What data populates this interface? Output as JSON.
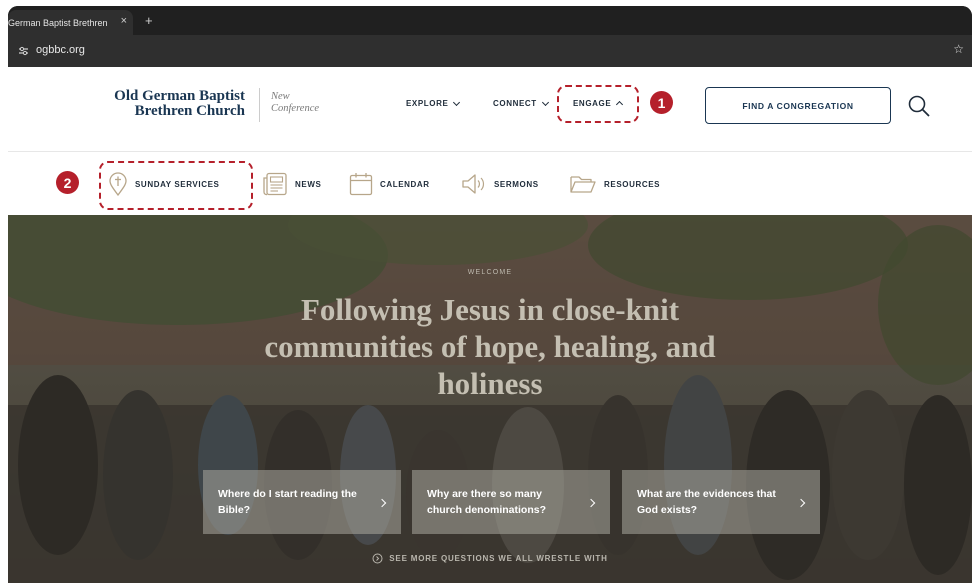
{
  "browser": {
    "tab_title": "German Baptist Brethren",
    "tab_close": "×",
    "new_tab": "+",
    "url": "ogbbc.org",
    "bookmark_icon": "star-icon"
  },
  "header": {
    "logo_line1": "Old German Baptist",
    "logo_line2": "Brethren Church",
    "logo_sub1": "New",
    "logo_sub2": "Conference",
    "nav": [
      {
        "label": "EXPLORE"
      },
      {
        "label": "CONNECT"
      },
      {
        "label": "ENGAGE"
      }
    ],
    "find_label": "FIND A CONGREGATION",
    "search_icon": "search-icon"
  },
  "subnav": [
    {
      "label": "SUNDAY SERVICES",
      "icon": "location-cross-icon"
    },
    {
      "label": "NEWS",
      "icon": "newspaper-icon"
    },
    {
      "label": "CALENDAR",
      "icon": "calendar-icon"
    },
    {
      "label": "SERMONS",
      "icon": "megaphone-icon"
    },
    {
      "label": "RESOURCES",
      "icon": "folder-icon"
    }
  ],
  "annotations": {
    "marker1": "1",
    "marker2": "2",
    "color": "#b5202b"
  },
  "hero": {
    "welcome": "WELCOME",
    "headline": "Following Jesus in close-knit communities of hope, healing, and holiness",
    "cards": [
      {
        "text": "Where do I start reading the Bible?"
      },
      {
        "text": "Why are there so many church denominations?"
      },
      {
        "text": "What are the evidences that God exists?"
      }
    ],
    "more_label": "SEE MORE QUESTIONS WE ALL WRESTLE WITH"
  },
  "colors": {
    "brand_navy": "#1a3652",
    "callout_red": "#b5202b"
  }
}
